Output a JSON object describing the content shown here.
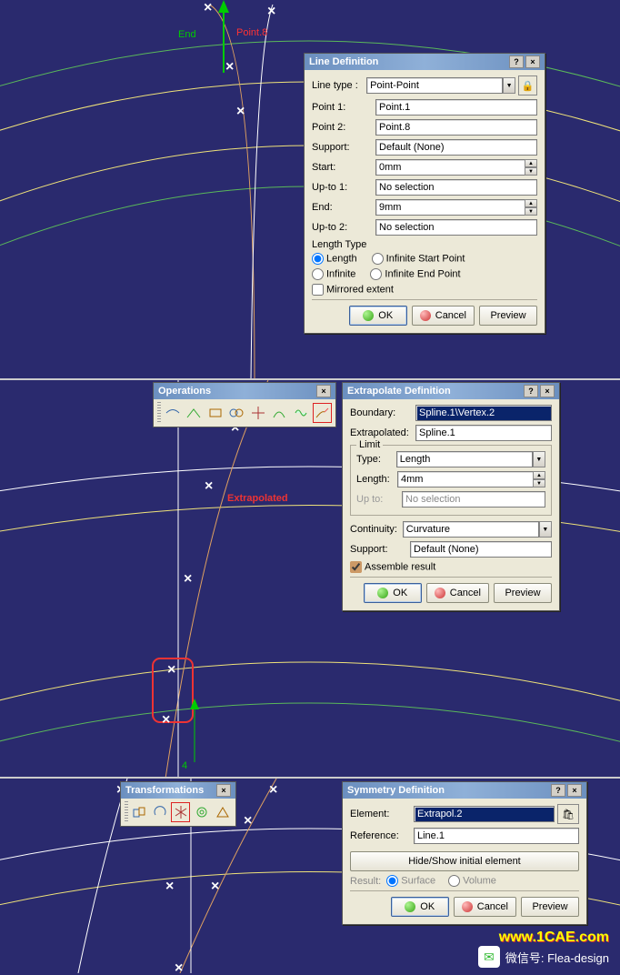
{
  "panel1": {
    "dialog": {
      "title": "Line Definition",
      "line_type_label": "Line type :",
      "line_type_value": "Point-Point",
      "point1_label": "Point 1:",
      "point1_value": "Point.1",
      "point2_label": "Point 2:",
      "point2_value": "Point.8",
      "support_label": "Support:",
      "support_value": "Default (None)",
      "start_label": "Start:",
      "start_value": "0mm",
      "upto1_label": "Up-to 1:",
      "upto1_value": "No selection",
      "end_label": "End:",
      "end_value": "9mm",
      "upto2_label": "Up-to 2:",
      "upto2_value": "No selection",
      "length_type_label": "Length Type",
      "radio_length": "Length",
      "radio_inf_start": "Infinite Start Point",
      "radio_infinite": "Infinite",
      "radio_inf_end": "Infinite End Point",
      "mirrored_label": "Mirrored extent",
      "ok": "OK",
      "cancel": "Cancel",
      "preview": "Preview"
    },
    "viewport": {
      "end_label": "End",
      "point_label": "Point.8"
    }
  },
  "panel2": {
    "toolbar_title": "Operations",
    "dialog": {
      "title": "Extrapolate Definition",
      "boundary_label": "Boundary:",
      "boundary_value": "Spline.1\\Vertex.2",
      "extrapolated_label": "Extrapolated:",
      "extrapolated_value": "Spline.1",
      "limit_label": "Limit",
      "type_label": "Type:",
      "type_value": "Length",
      "length_label": "Length:",
      "length_value": "4mm",
      "upto_label": "Up to:",
      "upto_value": "No selection",
      "continuity_label": "Continuity:",
      "continuity_value": "Curvature",
      "support_label": "Support:",
      "support_value": "Default (None)",
      "assemble_label": "Assemble result",
      "ok": "OK",
      "cancel": "Cancel",
      "preview": "Preview"
    },
    "viewport": {
      "extrapolated_label": "Extrapolated",
      "dim_value": "4"
    }
  },
  "panel3": {
    "toolbar_title": "Transformations",
    "dialog": {
      "title": "Symmetry Definition",
      "element_label": "Element:",
      "element_value": "Extrapol.2",
      "reference_label": "Reference:",
      "reference_value": "Line.1",
      "hideshow_label": "Hide/Show initial element",
      "result_label": "Result:",
      "radio_surface": "Surface",
      "radio_volume": "Volume",
      "ok": "OK",
      "cancel": "Cancel",
      "preview": "Preview"
    },
    "footer_text": "微信号: Flea-design",
    "link_text": "www.1CAE.com"
  }
}
